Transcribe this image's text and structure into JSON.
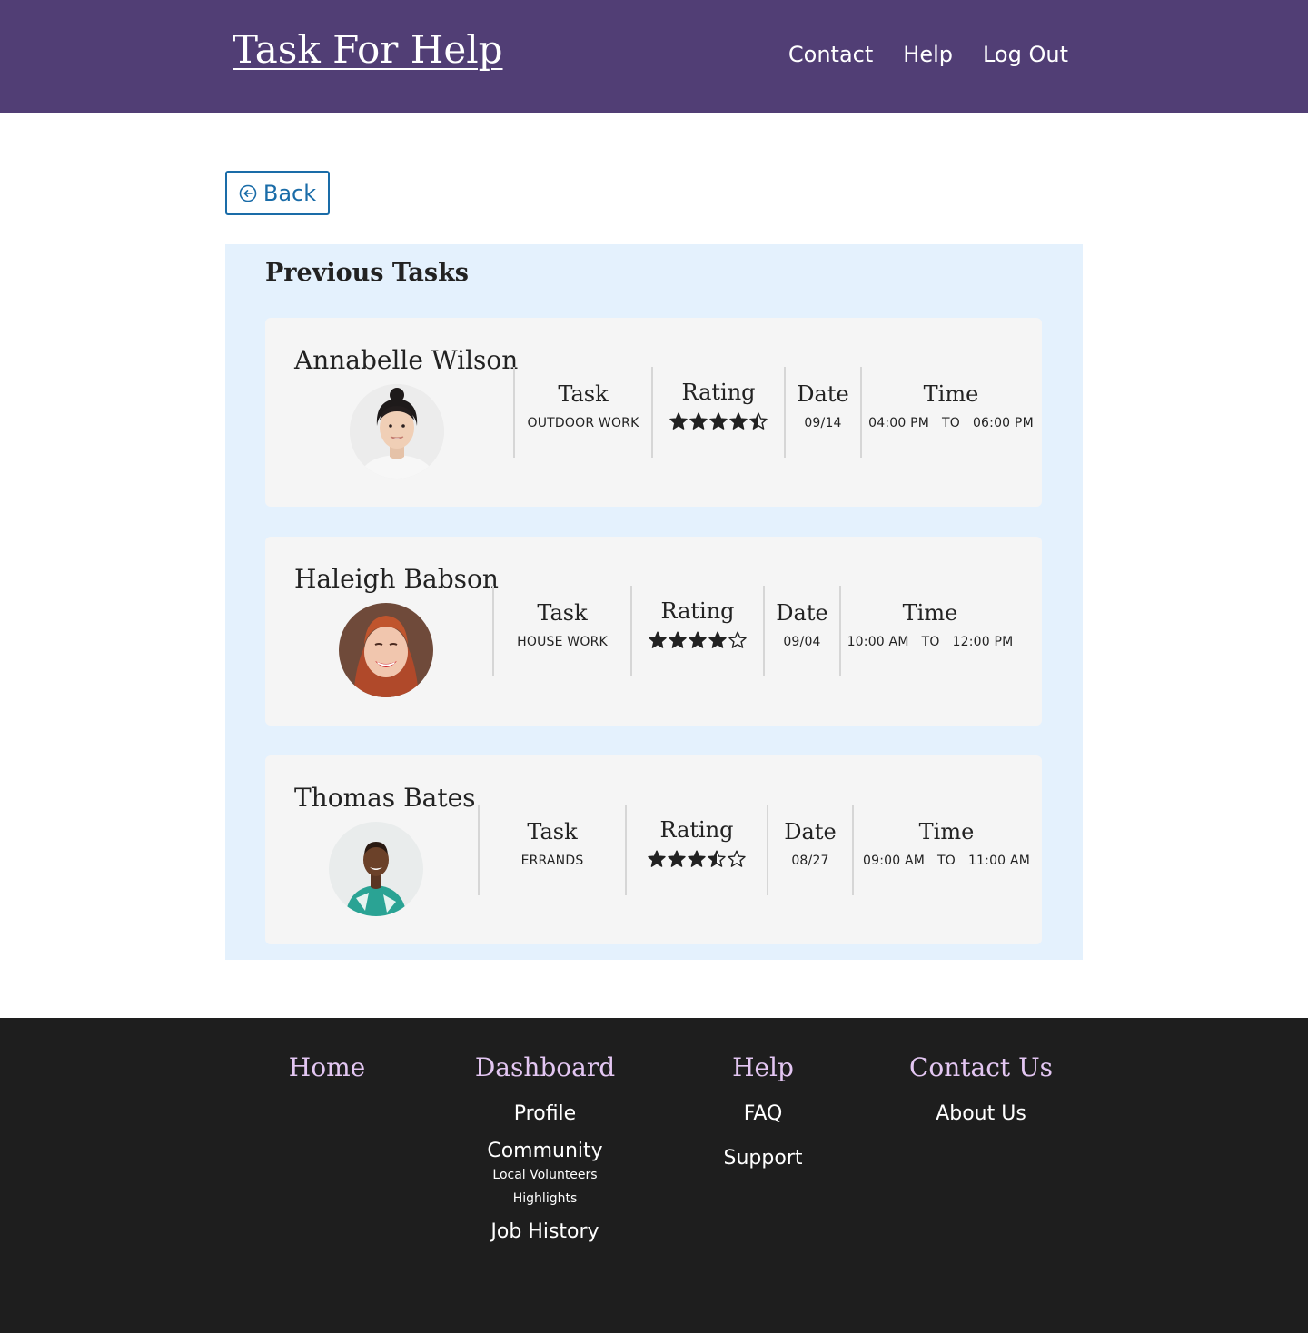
{
  "header": {
    "brand": "Task For Help",
    "nav": [
      "Contact",
      "Help",
      "Log Out"
    ]
  },
  "back_button": {
    "label": "Back",
    "icon": "arrow-left-circle-icon"
  },
  "panel": {
    "title": "Previous Tasks",
    "column_labels": {
      "task": "Task",
      "rating": "Rating",
      "date": "Date",
      "time": "Time",
      "time_separator": "TO"
    },
    "tasks": [
      {
        "name": "Annabelle Wilson",
        "avatar": "woman-with-top-bun-photo",
        "task": "OUTDOOR WORK",
        "rating": 4.5,
        "date": "09/14",
        "time_from": "04:00 PM",
        "time_to": "06:00 PM"
      },
      {
        "name": "Haleigh Babson",
        "avatar": "red-haired-woman-photo",
        "task": "HOUSE WORK",
        "rating": 4,
        "date": "09/04",
        "time_from": "10:00 AM",
        "time_to": "12:00 PM"
      },
      {
        "name": "Thomas Bates",
        "avatar": "man-in-teal-shirt-photo",
        "task": "ERRANDS",
        "rating": 3.5,
        "date": "08/27",
        "time_from": "09:00 AM",
        "time_to": "11:00 AM"
      }
    ]
  },
  "footer": {
    "home": "Home",
    "dashboard": {
      "title": "Dashboard",
      "profile": "Profile",
      "community": "Community",
      "local_volunteers": "Local Volunteers",
      "highlights": "Highlights",
      "job_history": "Job History"
    },
    "help": {
      "title": "Help",
      "faq": "FAQ",
      "support": "Support"
    },
    "contact": {
      "title": "Contact Us",
      "about": "About Us"
    }
  },
  "colors": {
    "header_bg": "#513e75",
    "panel_bg": "#e4f1fd",
    "card_bg": "#f5f5f5",
    "accent_link": "#1a6ca8",
    "footer_bg": "#1e1e1e",
    "footer_heading": "#e3c6f2"
  }
}
